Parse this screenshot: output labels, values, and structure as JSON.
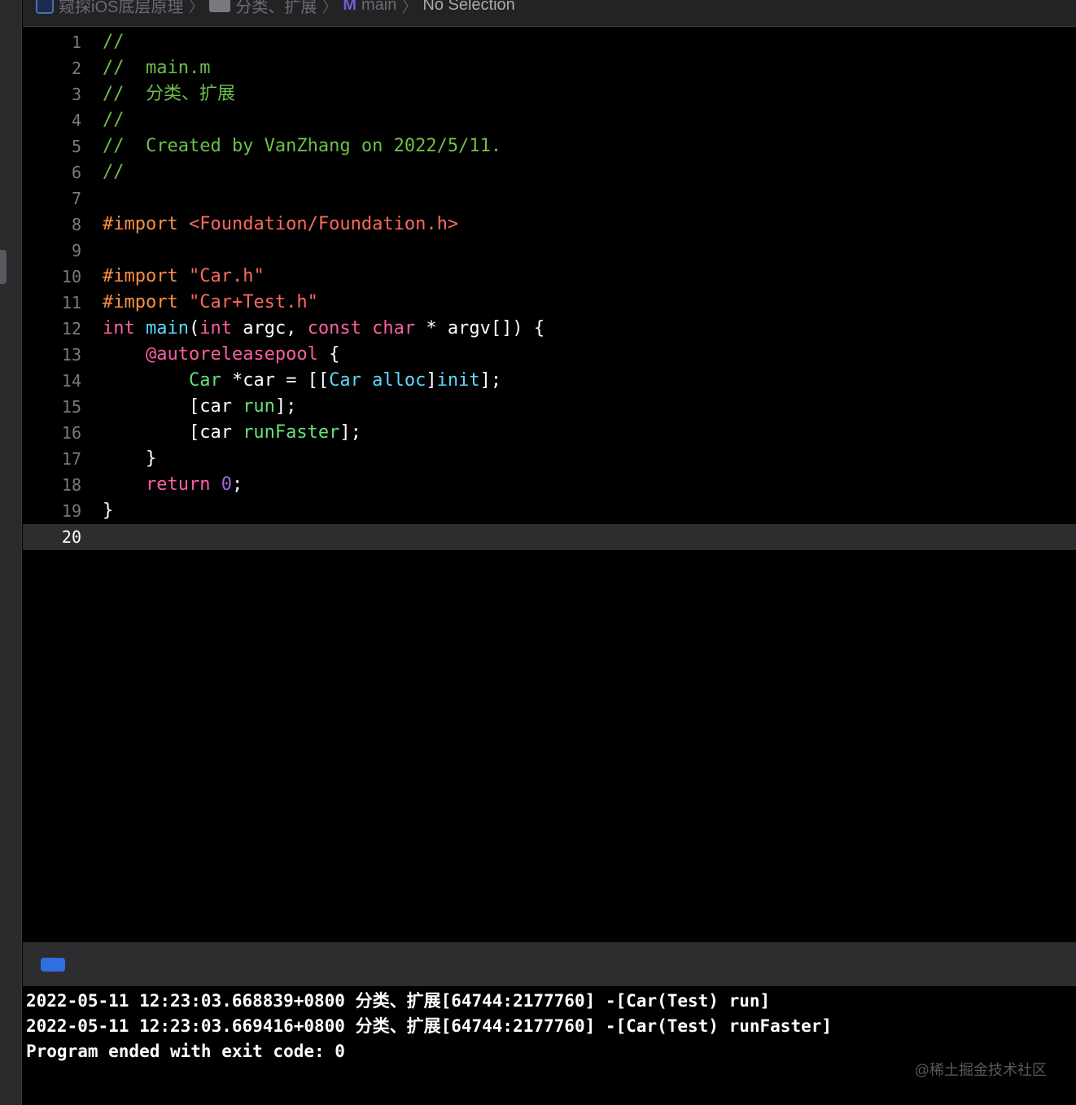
{
  "jumpbar": {
    "project": "窥探iOS底层原理",
    "group": "分类、扩展",
    "method_badge": "M",
    "file": "main",
    "selection": "No Selection",
    "separator": "〉"
  },
  "editor": {
    "current_line": 20,
    "lines": [
      {
        "n": "1",
        "tokens": [
          {
            "t": "//",
            "c": "comment"
          }
        ]
      },
      {
        "n": "2",
        "tokens": [
          {
            "t": "//  main.m",
            "c": "comment"
          }
        ]
      },
      {
        "n": "3",
        "tokens": [
          {
            "t": "//  分类、扩展",
            "c": "comment"
          }
        ]
      },
      {
        "n": "4",
        "tokens": [
          {
            "t": "//",
            "c": "comment"
          }
        ]
      },
      {
        "n": "5",
        "tokens": [
          {
            "t": "//  Created by VanZhang on 2022/5/11.",
            "c": "comment"
          }
        ]
      },
      {
        "n": "6",
        "tokens": [
          {
            "t": "//",
            "c": "comment"
          }
        ]
      },
      {
        "n": "7",
        "tokens": []
      },
      {
        "n": "8",
        "tokens": [
          {
            "t": "#import ",
            "c": "directive"
          },
          {
            "t": "<Foundation/Foundation.h>",
            "c": "string"
          }
        ]
      },
      {
        "n": "9",
        "tokens": []
      },
      {
        "n": "10",
        "tokens": [
          {
            "t": "#import ",
            "c": "directive"
          },
          {
            "t": "\"Car.h\"",
            "c": "string"
          }
        ]
      },
      {
        "n": "11",
        "tokens": [
          {
            "t": "#import ",
            "c": "directive"
          },
          {
            "t": "\"Car+Test.h\"",
            "c": "string"
          }
        ]
      },
      {
        "n": "12",
        "tokens": [
          {
            "t": "int ",
            "c": "keyword"
          },
          {
            "t": "main",
            "c": "class"
          },
          {
            "t": "(",
            "c": "plain"
          },
          {
            "t": "int ",
            "c": "keyword"
          },
          {
            "t": "argc, ",
            "c": "plain"
          },
          {
            "t": "const char ",
            "c": "keyword"
          },
          {
            "t": "* argv[]) {",
            "c": "plain"
          }
        ]
      },
      {
        "n": "13",
        "tokens": [
          {
            "t": "    ",
            "c": "plain"
          },
          {
            "t": "@autoreleasepool",
            "c": "keyword"
          },
          {
            "t": " {",
            "c": "plain"
          }
        ]
      },
      {
        "n": "14",
        "tokens": [
          {
            "t": "        ",
            "c": "plain"
          },
          {
            "t": "Car",
            "c": "green"
          },
          {
            "t": " *car = [[",
            "c": "plain"
          },
          {
            "t": "Car",
            "c": "class"
          },
          {
            "t": " ",
            "c": "plain"
          },
          {
            "t": "alloc",
            "c": "class"
          },
          {
            "t": "]",
            "c": "plain"
          },
          {
            "t": "init",
            "c": "class"
          },
          {
            "t": "];",
            "c": "plain"
          }
        ]
      },
      {
        "n": "15",
        "tokens": [
          {
            "t": "        [car ",
            "c": "plain"
          },
          {
            "t": "run",
            "c": "green"
          },
          {
            "t": "];",
            "c": "plain"
          }
        ]
      },
      {
        "n": "16",
        "tokens": [
          {
            "t": "        [car ",
            "c": "plain"
          },
          {
            "t": "runFaster",
            "c": "green"
          },
          {
            "t": "];",
            "c": "plain"
          }
        ]
      },
      {
        "n": "17",
        "tokens": [
          {
            "t": "    }",
            "c": "plain"
          }
        ]
      },
      {
        "n": "18",
        "tokens": [
          {
            "t": "    ",
            "c": "plain"
          },
          {
            "t": "return ",
            "c": "keyword"
          },
          {
            "t": "0",
            "c": "num"
          },
          {
            "t": ";",
            "c": "plain"
          }
        ]
      },
      {
        "n": "19",
        "tokens": [
          {
            "t": "}",
            "c": "plain"
          }
        ]
      },
      {
        "n": "20",
        "tokens": []
      }
    ]
  },
  "console": {
    "lines": [
      "2022-05-11 12:23:03.668839+0800 分类、扩展[64744:2177760] -[Car(Test) run]",
      "2022-05-11 12:23:03.669416+0800 分类、扩展[64744:2177760] -[Car(Test) runFaster]",
      "Program ended with exit code: 0"
    ]
  },
  "watermark": "@稀土掘金技术社区",
  "colors": {
    "comment": "#6cc04a",
    "directive": "#fd8f3f",
    "string": "#fc6a5d",
    "keyword": "#fc5fa3",
    "class": "#5dd8ff",
    "green": "#67e07a",
    "num": "#a167e6",
    "debug_toggle": "#2f6fe0"
  }
}
